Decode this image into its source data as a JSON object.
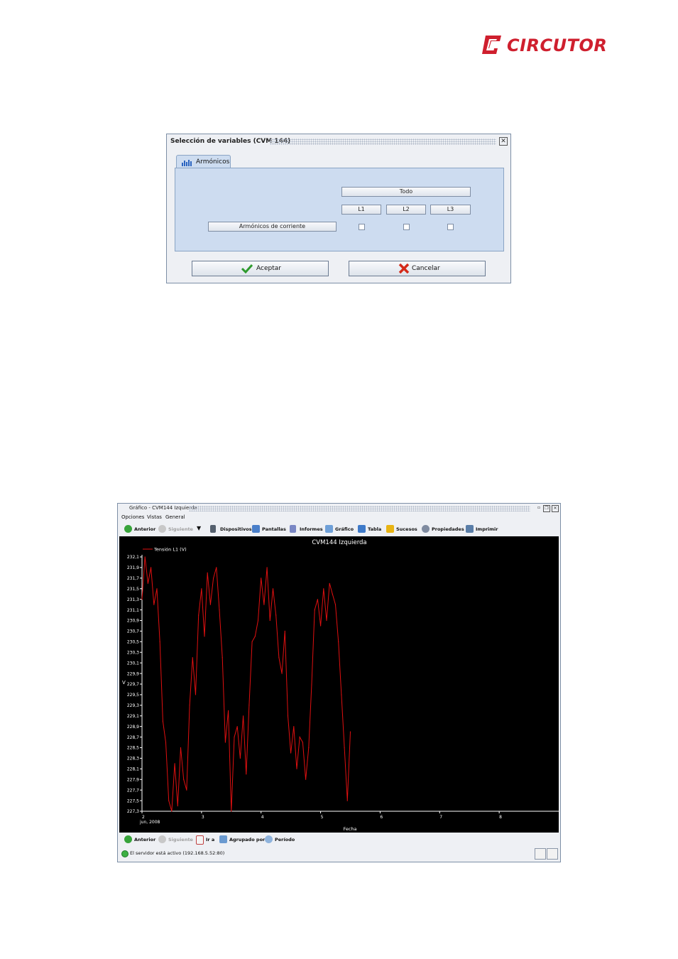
{
  "brand": {
    "name": "CIRCUTOR",
    "color": "#cf1f2e"
  },
  "dialog": {
    "title": "Selección de variables (CVM 144)",
    "close_icon": "close-icon",
    "tab_label": "Armónicos",
    "todo": "Todo",
    "phases": [
      "L1",
      "L2",
      "L3"
    ],
    "row_label": "Armónicos de corriente",
    "accept": "Aceptar",
    "cancel": "Cancelar"
  },
  "window": {
    "title": "Gráfico - CVM144 Izquierda",
    "menu": [
      "Opciones",
      "Vistas",
      "General"
    ],
    "toolbar": {
      "prev": "Anterior",
      "next": "Siguiente",
      "devices": "Dispositivos",
      "screens": "Pantallas",
      "reports": "Informes",
      "chart": "Gráfico",
      "table": "Tabla",
      "events": "Sucesos",
      "properties": "Propiedades",
      "print": "Imprimir"
    },
    "bottom_toolbar": {
      "prev": "Anterior",
      "next": "Siguiente",
      "goto": "Ir a",
      "grouped": "Agrupado por",
      "period": "Período"
    },
    "status": "El servidor está activo (192.168.5.52:80)"
  },
  "chart_data": {
    "type": "line",
    "title": "CVM144 Izquierda",
    "xlabel": "Fecha",
    "ylabel": "V",
    "x_ticks": [
      "2",
      "3",
      "4",
      "5",
      "6",
      "7",
      "8"
    ],
    "x_sublabel": "jun, 2008",
    "y_ticks": [
      "232,1",
      "231,9",
      "231,7",
      "231,5",
      "231,3",
      "231,1",
      "230,9",
      "230,7",
      "230,5",
      "230,3",
      "230,1",
      "229,9",
      "229,7",
      "229,5",
      "229,3",
      "229,1",
      "228,9",
      "228,7",
      "228,5",
      "228,3",
      "228,1",
      "227,9",
      "227,7",
      "227,5",
      "227,3"
    ],
    "ylim": [
      227.3,
      232.1
    ],
    "xlim": [
      2,
      9
    ],
    "legend_position": "top-left",
    "background": "#000000",
    "series": [
      {
        "name": "Tensión L1 (V)",
        "color": "#e01010",
        "x": [
          2.0,
          2.05,
          2.1,
          2.15,
          2.2,
          2.25,
          2.3,
          2.35,
          2.4,
          2.45,
          2.5,
          2.55,
          2.6,
          2.65,
          2.7,
          2.75,
          2.8,
          2.85,
          2.9,
          2.95,
          3.0,
          3.05,
          3.1,
          3.15,
          3.2,
          3.25,
          3.3,
          3.35,
          3.4,
          3.45,
          3.5,
          3.55,
          3.6,
          3.65,
          3.7,
          3.75,
          3.8,
          3.85,
          3.9,
          3.95,
          4.0,
          4.05,
          4.1,
          4.15,
          4.2,
          4.25,
          4.3,
          4.35,
          4.4,
          4.45,
          4.5,
          4.55,
          4.6,
          4.65,
          4.7,
          4.75,
          4.8,
          4.85,
          4.9,
          4.95,
          5.0,
          5.05,
          5.1,
          5.15,
          5.2,
          5.25,
          5.3,
          5.35,
          5.4,
          5.45,
          5.5
        ],
        "values": [
          231.3,
          232.1,
          231.6,
          231.9,
          231.2,
          231.5,
          230.5,
          229.0,
          228.6,
          227.5,
          227.3,
          228.2,
          227.4,
          228.5,
          227.9,
          227.7,
          229.3,
          230.2,
          229.5,
          231.0,
          231.5,
          230.6,
          231.8,
          231.2,
          231.7,
          231.9,
          231.1,
          230.2,
          228.6,
          229.2,
          227.3,
          228.7,
          228.9,
          228.3,
          229.1,
          228.0,
          229.3,
          230.5,
          230.6,
          230.9,
          231.7,
          231.2,
          231.9,
          230.9,
          231.5,
          231.0,
          230.2,
          229.9,
          230.7,
          229.1,
          228.4,
          228.9,
          228.1,
          228.7,
          228.6,
          227.9,
          228.5,
          229.7,
          231.1,
          231.3,
          230.8,
          231.5,
          230.9,
          231.6,
          231.4,
          231.2,
          230.5,
          229.5,
          228.5,
          227.5,
          228.8
        ]
      }
    ]
  }
}
